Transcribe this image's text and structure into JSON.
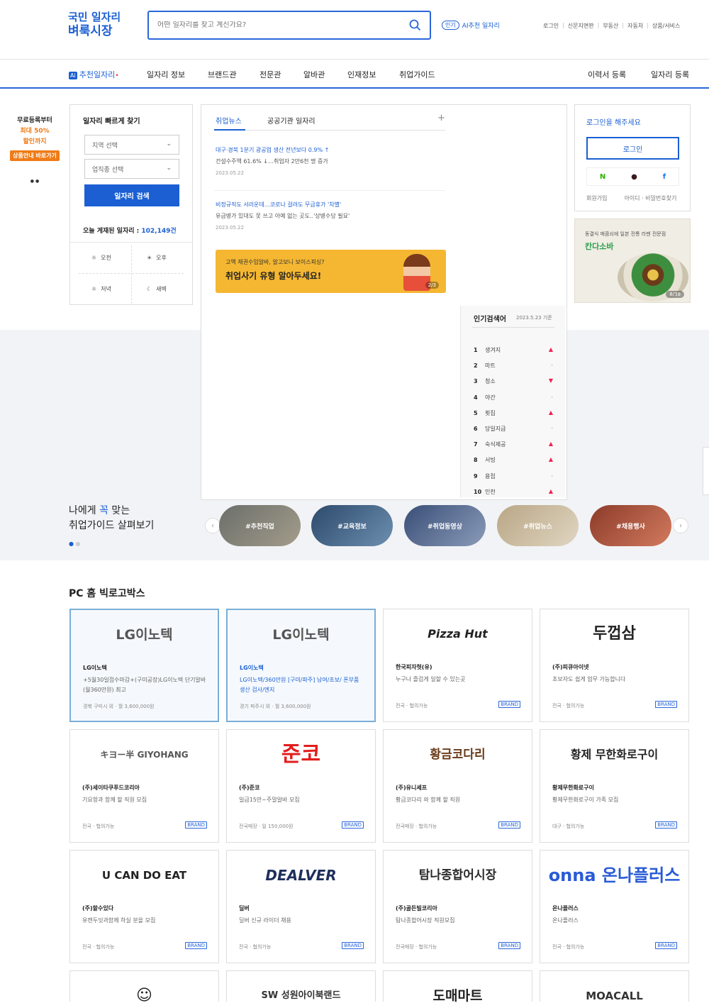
{
  "header": {
    "logo_line1": "국민 일자리",
    "logo_line2": "벼룩시장",
    "search_placeholder": "어떤 일자리를 찾고 계신가요?",
    "ai_pill": "인기",
    "ai_link": "AI추천 일자리",
    "top_links": [
      "로그인",
      "신문지면판",
      "부동산",
      "자동차",
      "상품/서비스"
    ]
  },
  "nav": {
    "ai_badge": "Ai",
    "items": [
      "추천일자리",
      "일자리 정보",
      "브랜드관",
      "전문관",
      "알바관",
      "인재정보",
      "취업가이드"
    ],
    "right_items": [
      "이력서 등록",
      "일자리 등록"
    ]
  },
  "promo": {
    "line1": "무료등록부터",
    "line2": "최대 50%",
    "line3": "할인까지",
    "button": "상품안내 바로가기",
    "dots": "● ●"
  },
  "quick_search": {
    "title": "일자리 빠르게 찾기",
    "region": "지역 선택",
    "job": "업직종 선택",
    "button": "일자리 검색",
    "count_label": "오늘 게재된 일자리 :",
    "count": "102,149건",
    "times": [
      "오전",
      "오후",
      "저녁",
      "새벽"
    ]
  },
  "news": {
    "tabs": [
      "취업뉴스",
      "공공기관 일자리"
    ],
    "plus": "+",
    "items": [
      {
        "headline": "대구·경북 1분기 광공업 생산 전년보다 0.9% ↑",
        "body": "건설수주액 61.6% ↓…취업자 2만6천 명 증가",
        "date": "2023.05.22"
      },
      {
        "headline": "비정규직도 서러운데…코로나 걸려도 무급휴가 '차별'",
        "body": "유급병가 있대도 못 쓰고 아예 없는 곳도..'상병수당 필요'",
        "date": "2023.05.22"
      }
    ],
    "banner_sub": "고액 재권수임알바, 알고보니 보이스피싱?",
    "banner_main": "취업사기 유형 알아두세요!",
    "banner_page": "2/3",
    "popular_title": "인기검색어",
    "popular_date": "2023.5.23 기준",
    "keywords": [
      {
        "rank": "1",
        "word": "생겨지",
        "trend": "▲"
      },
      {
        "rank": "2",
        "word": "마트",
        "trend": "-"
      },
      {
        "rank": "3",
        "word": "청소",
        "trend": "▼"
      },
      {
        "rank": "4",
        "word": "야간",
        "trend": "-"
      },
      {
        "rank": "5",
        "word": "횟집",
        "trend": "▲"
      },
      {
        "rank": "6",
        "word": "당일지급",
        "trend": "-"
      },
      {
        "rank": "7",
        "word": "숙식제공",
        "trend": "▲"
      },
      {
        "rank": "8",
        "word": "서빙",
        "trend": "▲"
      },
      {
        "rank": "9",
        "word": "용접",
        "trend": "-"
      },
      {
        "rank": "10",
        "word": "인천",
        "trend": "▲"
      }
    ]
  },
  "login": {
    "title": "로그인을 해주세요",
    "button": "로그인",
    "socials": [
      "N",
      "●",
      "f"
    ],
    "bottom": [
      "회원가입",
      "아이디 · 비밀번호찾기"
    ]
  },
  "ad": {
    "sub": "동결식 매콤쇠에 일본 전통 라멘 전문점",
    "main": "칸다소바",
    "page": "8/38"
  },
  "guide": {
    "line1_pre": "나에게 ",
    "line1_em": "꼭",
    "line1_post": " 맞는",
    "line2": "취업가이드 살펴보기",
    "cards": [
      "#추천직업",
      "#교육정보",
      "#취업동영상",
      "#취업뉴스",
      "#채용행사"
    ]
  },
  "bigbox": {
    "title": "PC 홈 빅로고박스",
    "cards": [
      {
        "logo": "LG이노텍",
        "company": "LG이노텍",
        "desc": "+5월30일접수마감+(구미공장)LG이노텍 단기알바(월360만원) 최고",
        "loc": "경북 구미시 외 · 월 3,600,000원",
        "brand": ""
      },
      {
        "logo": "LG이노텍",
        "company": "LG이노텍",
        "desc": "LG이노텍/360만원 [구미/파주] 남여/초보/ 폰부품 생산 검사/엔지",
        "loc": "경기 파주시 외 · 월 3,600,000원",
        "brand": ""
      },
      {
        "logo": "Pizza Hut",
        "company": "한국피자헛(유)",
        "desc": "누구나 즐겁게 일할 수 있는곳",
        "loc": "전국 · 협의가능",
        "brand": "BRAND"
      },
      {
        "logo": "두껍삼",
        "company": "(주)피큐아이넷",
        "desc": "초보자도 쉽게 업무 가능합니다",
        "loc": "전국 · 협의가능",
        "brand": "BRAND"
      },
      {
        "logo": "キヨー半 GIYOHANG",
        "company": "(주)세이타쿠푸드코리아",
        "desc": "기요항과 함께 할 직원 모집",
        "loc": "전국 · 협의가능",
        "brand": "BRAND"
      },
      {
        "logo": "준코",
        "company": "(주)준코",
        "desc": "일급15만~주말알바 모집",
        "loc": "전국매장 · 일 150,000원",
        "brand": "BRAND"
      },
      {
        "logo": "황금코다리",
        "company": "(주)유니셰프",
        "desc": "황금코다리 와 함께 할 직원",
        "loc": "전국매장 · 협의가능",
        "brand": "BRAND"
      },
      {
        "logo": "황제 무한화로구이",
        "company": "황제무한화로구이",
        "desc": "황제무한화로구이 가족 모집",
        "loc": "대구 · 협의가능",
        "brand": "BRAND"
      },
      {
        "logo": "U CAN DO EAT",
        "company": "(주)할수있다",
        "desc": "유캔두잇과함께 하실 분을 모집",
        "loc": "전국 · 협의가능",
        "brand": "BRAND"
      },
      {
        "logo": "DEALVER",
        "company": "딜버",
        "desc": "딜버 신규 라이더 채용",
        "loc": "전국 · 협의가능",
        "brand": "BRAND"
      },
      {
        "logo": "탐나종합어시장",
        "company": "(주)골든빌코리아",
        "desc": "탐나종합어시장 직원모집",
        "loc": "전국매장 · 협의가능",
        "brand": "BRAND"
      },
      {
        "logo": "onna 온나플러스",
        "company": "온나플러스",
        "desc": "온나플러스",
        "loc": "전국 · 협의가능",
        "brand": "BRAND"
      },
      {
        "logo": "☺",
        "company": "",
        "desc": "",
        "loc": "",
        "brand": ""
      },
      {
        "logo": "SW 성원아이북랜드",
        "company": "",
        "desc": "",
        "loc": "",
        "brand": ""
      },
      {
        "logo": "도매마트",
        "company": "",
        "desc": "",
        "loc": "",
        "brand": ""
      },
      {
        "logo": "MOACALL",
        "company": "",
        "desc": "",
        "loc": "",
        "brand": ""
      }
    ]
  },
  "colors": {
    "brand": "#1b5fd3",
    "orange": "#f07b16",
    "banner": "#f5b731"
  }
}
